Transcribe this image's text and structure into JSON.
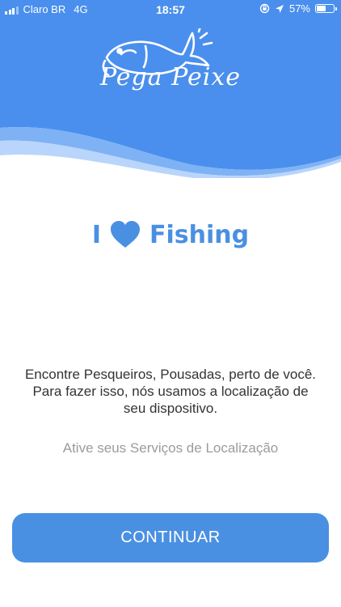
{
  "status_bar": {
    "carrier": "Claro BR",
    "network": "4G",
    "time": "18:57",
    "battery": "57%",
    "battery_level": 0.57
  },
  "header": {
    "app_name": "Pega Peixe",
    "background_color": "#4a90e2",
    "logo_icon": "fish-icon"
  },
  "slogan": {
    "prefix": "I",
    "icon": "heart-icon",
    "suffix": "Fishing"
  },
  "description": "Encontre Pesqueiros, Pousadas, perto de você. Para fazer isso, nós usamos a localização de seu dispositivo.",
  "hint": "Ative seus Serviços de Localização",
  "continue_label": "CONTINUAR",
  "colors": {
    "primary": "#4a90e2",
    "text": "#333333",
    "muted": "#9b9b9b"
  }
}
